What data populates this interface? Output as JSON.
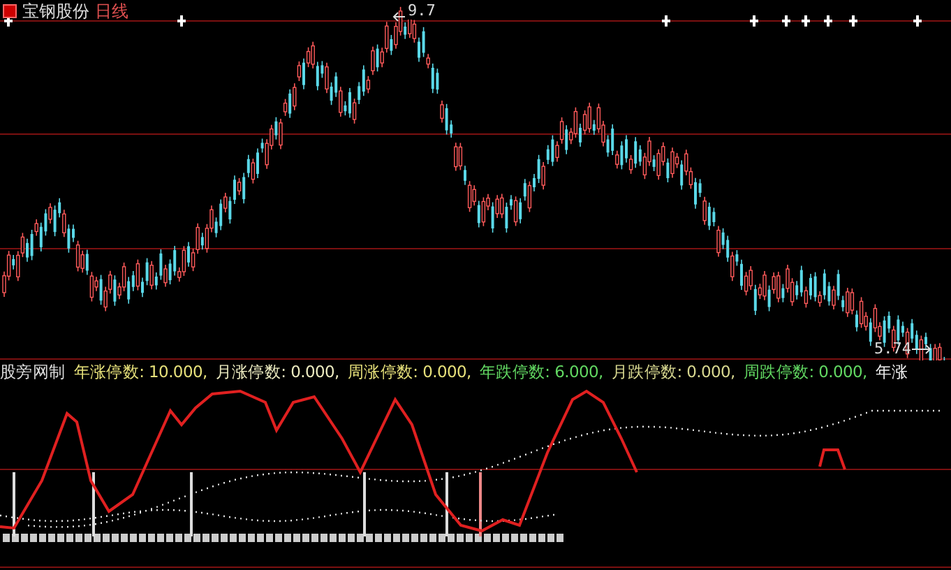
{
  "header": {
    "stock_name": "宝钢股份",
    "period": "日线"
  },
  "price_chart": {
    "high_label": "9.7",
    "low_label": "5.74"
  },
  "indicator": {
    "name": "股旁网制",
    "items": [
      {
        "text": "年涨停数: 10.000,",
        "color": "#e6e07a"
      },
      {
        "text": "月涨停数: 0.000,",
        "color": "#ecebc0"
      },
      {
        "text": "周涨停数: 0.000,",
        "color": "#e6e07a"
      },
      {
        "text": "年跌停数: 6.000,",
        "color": "#62d862"
      },
      {
        "text": "月跌停数: 0.000,",
        "color": "#d8d890"
      },
      {
        "text": "周跌停数: 0.000,",
        "color": "#62d862"
      },
      {
        "text": "年涨",
        "color": "#f0f0f0"
      }
    ]
  }
}
